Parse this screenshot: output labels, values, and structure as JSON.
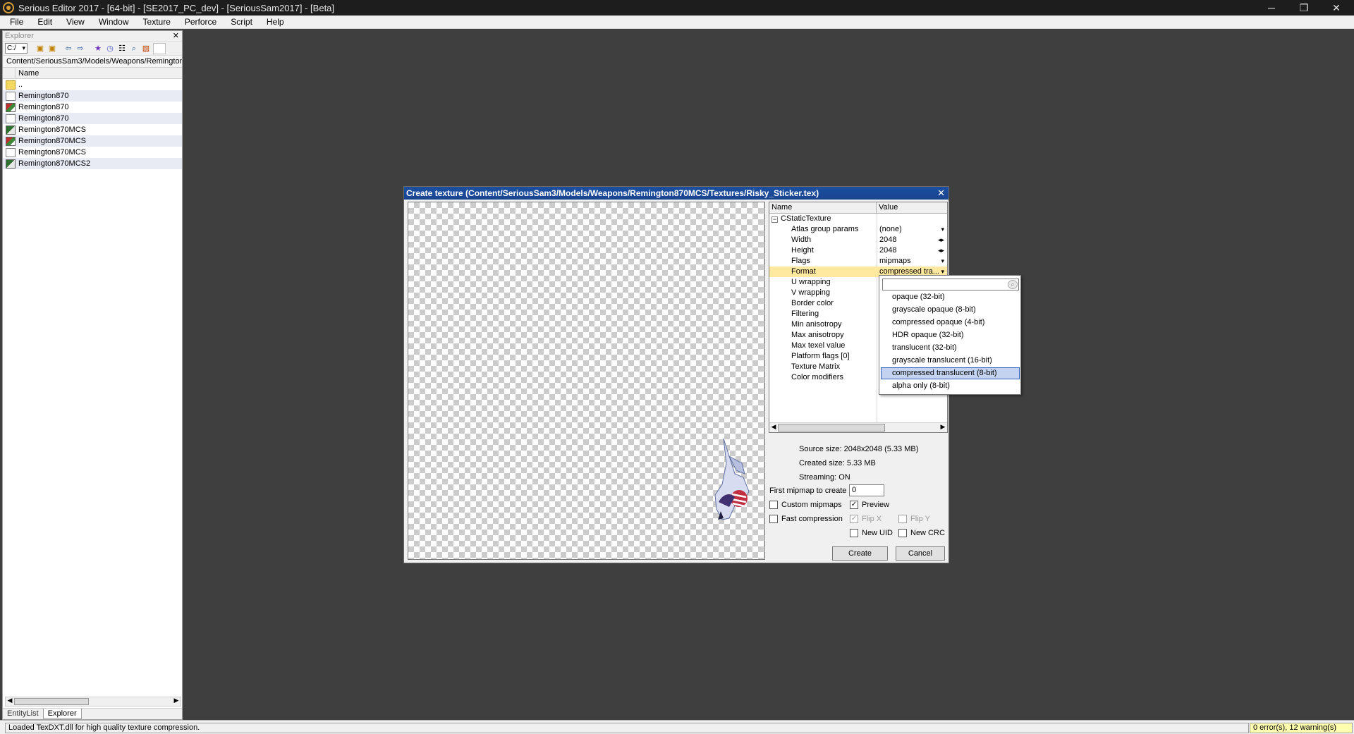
{
  "window": {
    "title": "Serious Editor 2017 - [64-bit] - [SE2017_PC_dev] - [SeriousSam2017] - [Beta]",
    "minimize": "─",
    "restore": "❐",
    "close": "✕"
  },
  "menu": [
    "File",
    "Edit",
    "View",
    "Window",
    "Texture",
    "Perforce",
    "Script",
    "Help"
  ],
  "explorer": {
    "title": "Explorer",
    "close": "✕",
    "drive": "C:/",
    "path": "Content/SeriousSam3/Models/Weapons/Remington",
    "column_name": "Name",
    "files": [
      {
        "name": "..",
        "icon": "folder-icon"
      },
      {
        "name": "Remington870",
        "icon": "document-icon"
      },
      {
        "name": "Remington870",
        "icon": "texture-icon"
      },
      {
        "name": "Remington870",
        "icon": "document-icon"
      },
      {
        "name": "Remington870MCS",
        "icon": "model-icon"
      },
      {
        "name": "Remington870MCS",
        "icon": "texture-icon"
      },
      {
        "name": "Remington870MCS",
        "icon": "document-icon"
      },
      {
        "name": "Remington870MCS2",
        "icon": "model-icon"
      }
    ],
    "tabs": [
      "EntityList",
      "Explorer"
    ],
    "active_tab": "Explorer"
  },
  "dialog": {
    "title": "Create texture (Content/SeriousSam3/Models/Weapons/Remington870MCS/Textures/Risky_Sticker.tex)",
    "close": "✕",
    "grid": {
      "col_name": "Name",
      "col_value": "Value",
      "group": "CStaticTexture",
      "rows": [
        {
          "name": "Atlas group params",
          "value": "(none)",
          "ctl": "▾"
        },
        {
          "name": "Width",
          "value": "2048",
          "ctl": "◂▸"
        },
        {
          "name": "Height",
          "value": "2048",
          "ctl": "◂▸"
        },
        {
          "name": "Flags",
          "value": "mipmaps",
          "ctl": "▾"
        },
        {
          "name": "Format",
          "value": "compressed tra...",
          "ctl": "▾",
          "selected": true
        },
        {
          "name": "U wrapping",
          "value": ""
        },
        {
          "name": "V wrapping",
          "value": ""
        },
        {
          "name": "Border color",
          "value": ""
        },
        {
          "name": "Filtering",
          "value": ""
        },
        {
          "name": "Min anisotropy",
          "value": ""
        },
        {
          "name": "Max anisotropy",
          "value": ""
        },
        {
          "name": "Max texel value",
          "value": ""
        },
        {
          "name": "Platform flags [0]",
          "value": ""
        },
        {
          "name": "Texture Matrix",
          "value": ""
        },
        {
          "name": "Color modifiers",
          "value": ""
        }
      ]
    },
    "info": {
      "source_size": "Source size: 2048x2048 (5.33 MB)",
      "created_size": "Created size: 5.33 MB",
      "streaming": "Streaming: ON"
    },
    "first_mipmap_label": "First mipmap to create",
    "first_mipmap_value": "0",
    "checkboxes": {
      "custom_mipmaps": {
        "label": "Custom mipmaps",
        "checked": false
      },
      "preview": {
        "label": "Preview",
        "checked": true
      },
      "fast_compression": {
        "label": "Fast compression",
        "checked": false
      },
      "flip_x": {
        "label": "Flip X",
        "checked": true
      },
      "flip_y": {
        "label": "Flip Y",
        "checked": false
      },
      "new_uid": {
        "label": "New UID",
        "checked": false
      },
      "new_crc": {
        "label": "New CRC",
        "checked": false
      }
    },
    "create_label": "Create",
    "cancel_label": "Cancel"
  },
  "format_dropdown": {
    "search_value": "",
    "options": [
      "opaque (32-bit)",
      "grayscale opaque (8-bit)",
      "compressed opaque (4-bit)",
      "HDR opaque (32-bit)",
      "translucent (32-bit)",
      "grayscale translucent (16-bit)",
      "compressed translucent (8-bit)",
      "alpha only (8-bit)"
    ],
    "selected": "compressed translucent (8-bit)"
  },
  "status": {
    "message": "Loaded TexDXT.dll for high quality texture compression.",
    "warnings": "0 error(s), 12 warning(s)"
  },
  "colors": {
    "selected_row": "#ffe8a0",
    "warning_bg": "#ffffb0",
    "dialog_title": "#1b4fa0"
  }
}
